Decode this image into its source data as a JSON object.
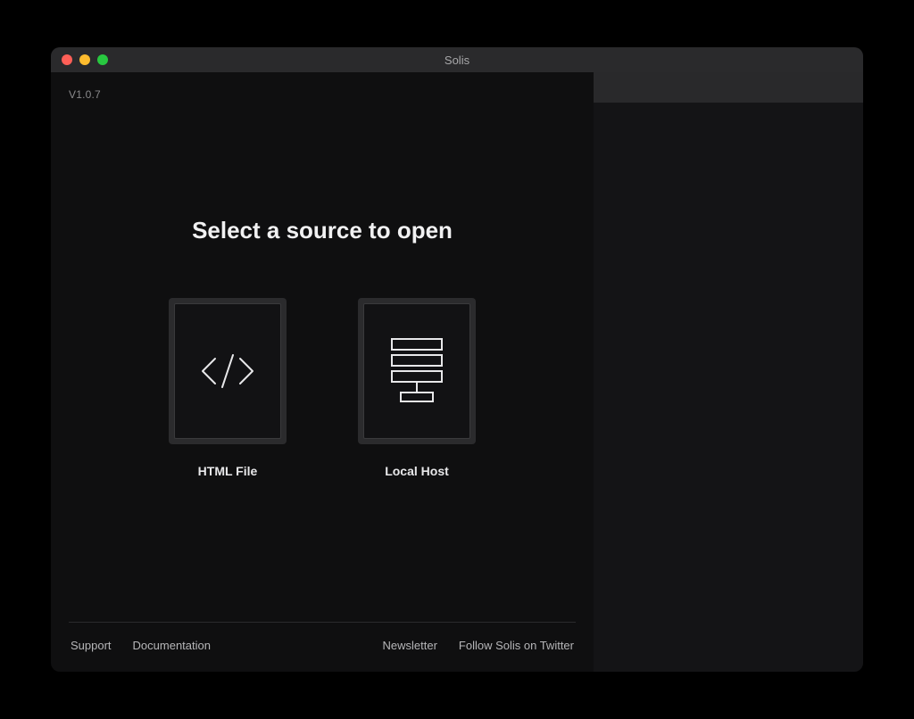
{
  "window": {
    "title": "Solis"
  },
  "version": "V1.0.7",
  "main": {
    "heading": "Select a source to open",
    "options": [
      {
        "label": "HTML File",
        "icon": "code-icon"
      },
      {
        "label": "Local Host",
        "icon": "server-icon"
      }
    ]
  },
  "footer": {
    "left": [
      {
        "label": "Support"
      },
      {
        "label": "Documentation"
      }
    ],
    "right": [
      {
        "label": "Newsletter"
      },
      {
        "label": "Follow Solis on Twitter"
      }
    ]
  }
}
